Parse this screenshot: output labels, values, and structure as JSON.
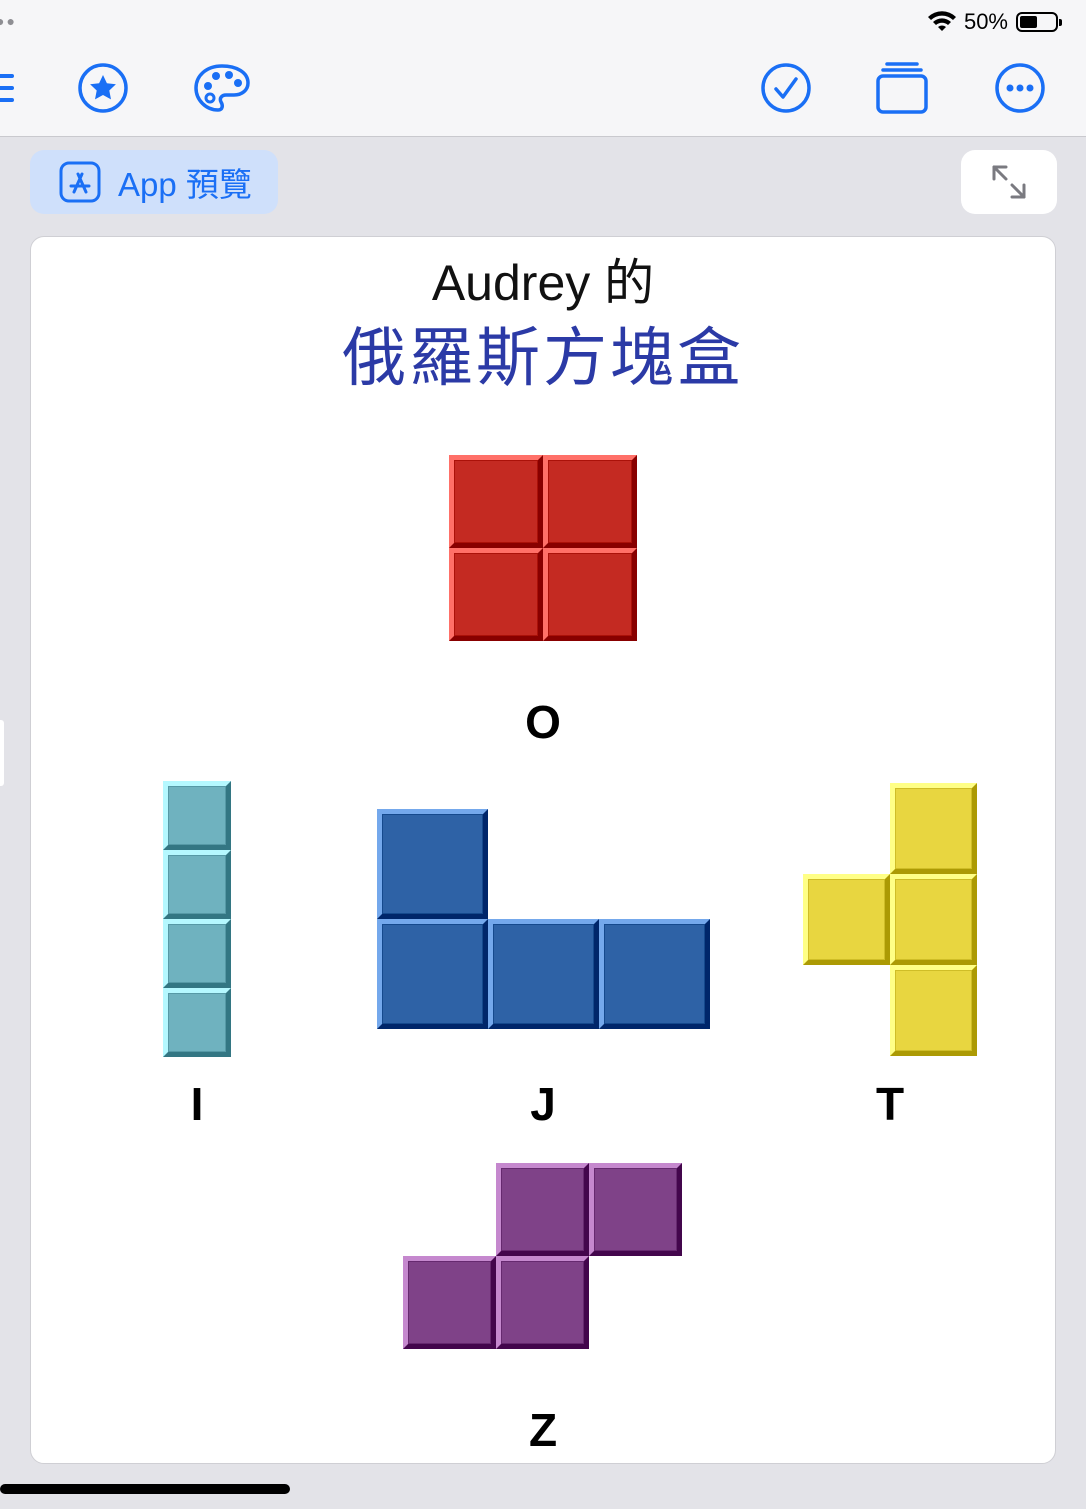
{
  "status": {
    "battery_text": "50%",
    "battery_level": 0.5
  },
  "toolbar": {
    "icons": [
      "list-icon",
      "star-icon",
      "palette-icon",
      "checkmark-icon",
      "windows-icon",
      "more-icon"
    ]
  },
  "preview": {
    "app_preview_label": "App 預覽"
  },
  "content": {
    "title_line1": "Audrey 的",
    "title_line2": "俄羅斯方塊盒",
    "pieces": [
      {
        "name": "O",
        "label": "O",
        "color": "#c42a22"
      },
      {
        "name": "I",
        "label": "I",
        "color": "#6fb2bf"
      },
      {
        "name": "J",
        "label": "J",
        "color": "#2e62a6"
      },
      {
        "name": "T",
        "label": "T",
        "color": "#e8d640"
      },
      {
        "name": "Z",
        "label": "Z",
        "color": "#7f4288"
      }
    ]
  }
}
